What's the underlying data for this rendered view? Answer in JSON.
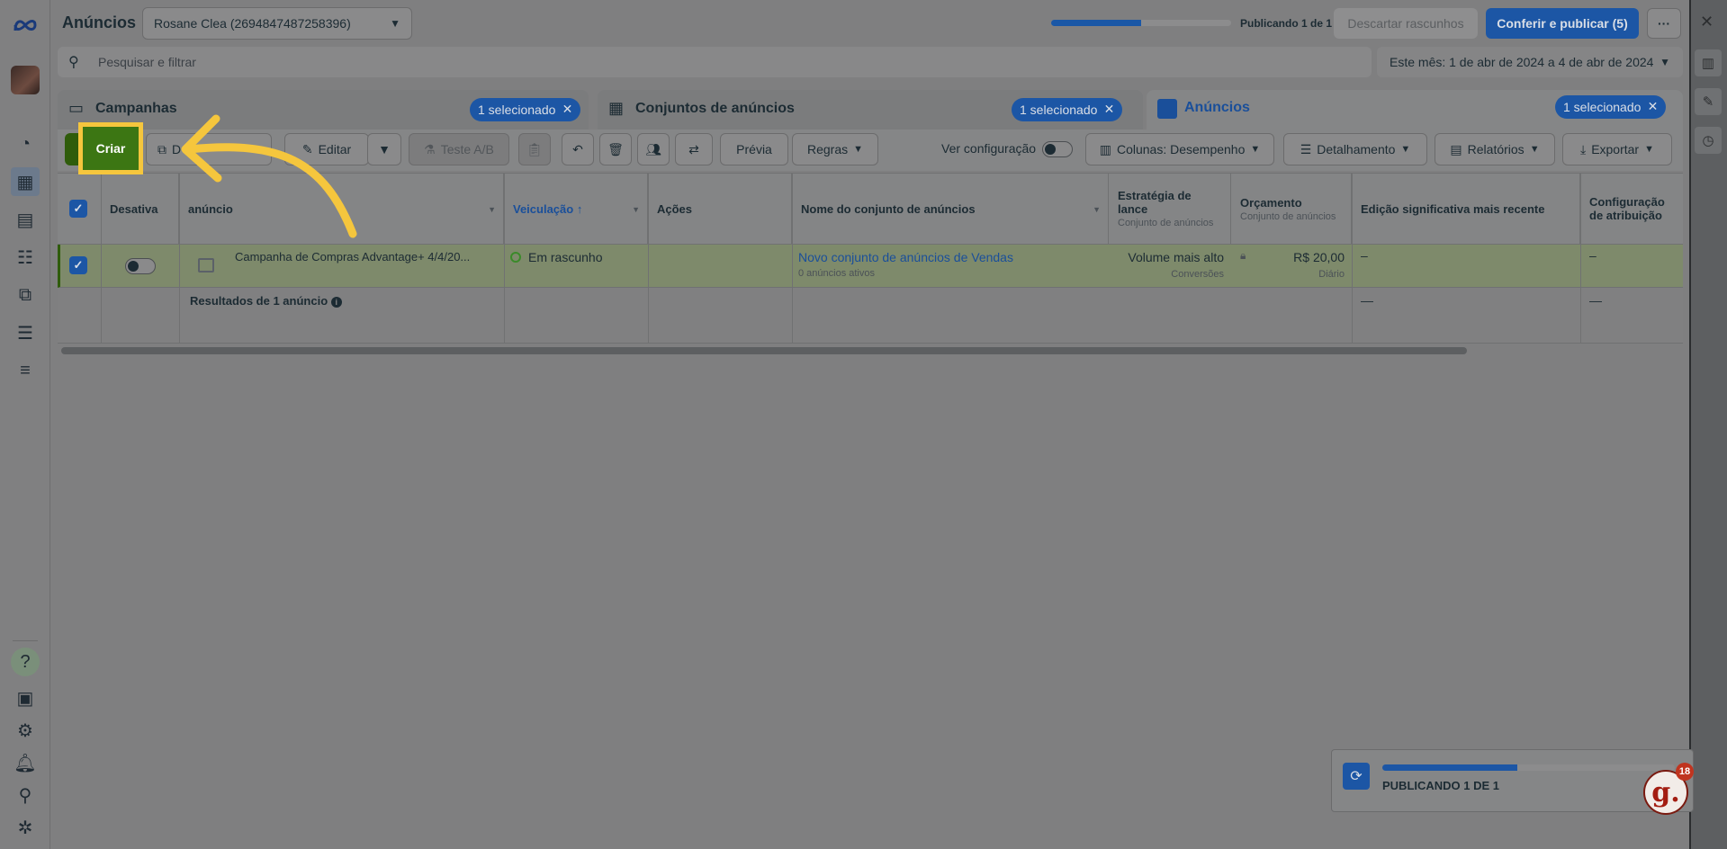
{
  "header": {
    "title": "Anúncios",
    "account": "Rosane Clea (2694847487258396)",
    "publish_progress": 0.5,
    "publish_status": "Publicando 1 de 1",
    "discard_label": "Descartar rascunhos",
    "publish_label": "Conferir e publicar (5)",
    "more_label": "···"
  },
  "search": {
    "placeholder": "Pesquisar e filtrar",
    "date_range": "Este mês: 1 de abr de 2024 a 4 de abr de 2024"
  },
  "tabs": [
    {
      "label": "Campanhas",
      "selected": "1 selecionado"
    },
    {
      "label": "Conjuntos de anúncios",
      "selected": "1 selecionado"
    },
    {
      "label": "Anúncios",
      "selected": "1 selecionado"
    }
  ],
  "toolbar": {
    "create_label": "Criar",
    "duplicate_label": "D",
    "edit_label": "Editar",
    "ab_test_label": "Teste A/B",
    "preview_label": "Prévia",
    "rules_label": "Regras",
    "view_config_label": "Ver configuração",
    "columns_label": "Colunas: Desempenho",
    "breakdown_label": "Detalhamento",
    "reports_label": "Relatórios",
    "export_label": "Exportar"
  },
  "table": {
    "headers": {
      "toggle": "Desativa",
      "name": "anúncio",
      "delivery": "Veiculação",
      "actions": "Ações",
      "adset_name": "Nome do conjunto de anúncios",
      "bid_strategy": "Estratégia de lance",
      "bid_strategy_sub": "Conjunto de anúncios",
      "budget": "Orçamento",
      "budget_sub": "Conjunto de anúncios",
      "last_edit": "Edição significativa mais recente",
      "attribution": "Configuração de atribuição"
    },
    "row": {
      "name": "Campanha de Compras Advantage+ 4/4/20...",
      "delivery": "Em rascunho",
      "adset_name": "Novo conjunto de anúncios de Vendas",
      "adset_sub": "0 anúncios ativos",
      "bid_strategy": "Volume mais alto",
      "bid_strategy_sub": "Conversões",
      "budget": "R$ 20,00",
      "budget_sub": "Diário",
      "last_edit": "–",
      "attribution": "–"
    },
    "results": {
      "label": "Resultados de 1 anúncio",
      "last_edit": "—",
      "attribution": "—"
    }
  },
  "popup": {
    "status": "PUBLICANDO 1 DE 1",
    "progress": 0.5
  },
  "badge": {
    "letter": "g.",
    "count": "18"
  },
  "colors": {
    "accent": "#1c56a5",
    "create": "#3c7613",
    "highlight": "#f5c63d"
  }
}
